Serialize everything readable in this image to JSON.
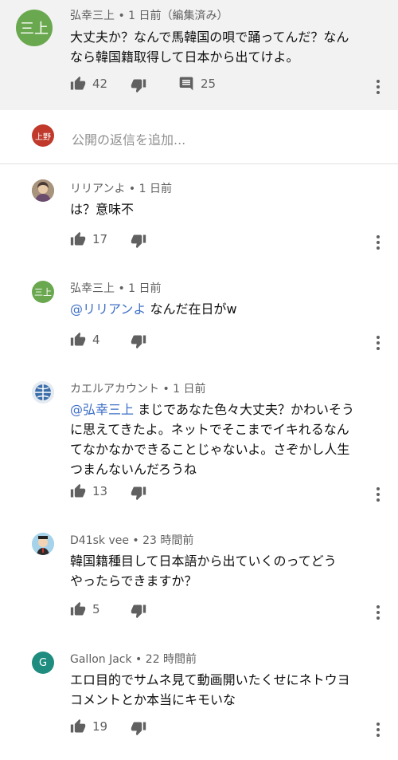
{
  "parent": {
    "avatar_text": "三上",
    "author": "弘幸三上",
    "time": "1 日前（編集済み）",
    "text_line1": "大丈夫か？なんで馬韓国の唄で踊ってんだ？なん",
    "text_line2": "なら韓国籍取得して日本から出てけよ。",
    "likes": "42",
    "replies": "25"
  },
  "reply_box": {
    "avatar_text": "上野",
    "placeholder": "公開の返信を追加..."
  },
  "replies": [
    {
      "author": "リリアンよ",
      "time": "1 日前",
      "lines": [
        "は？意味不"
      ],
      "likes": "17"
    },
    {
      "author": "弘幸三上",
      "avatar_text": "三上",
      "time": "1 日前",
      "mention": "@リリアンよ",
      "mention_rest": " なんだ在日がw",
      "likes": "4"
    },
    {
      "author": "カエルアカウント",
      "time": "1 日前",
      "mention": "@弘幸三上",
      "mention_rest": " まじであなた色々大丈夫？かわいそう",
      "lines": [
        "に思えてきたよ。ネットでそこまでイキれるなん",
        "てなかなかできることじゃないよ。さぞかし人生",
        "つまんないんだろうね"
      ],
      "likes": "13"
    },
    {
      "author": "D41sk vee",
      "time": "23 時間前",
      "lines": [
        "韓国籍種目して日本語から出ていくのってどう",
        "やったらできますか？"
      ],
      "likes": "5"
    },
    {
      "author": "Gallon Jack",
      "avatar_text": "G",
      "time": "22 時間前",
      "lines": [
        "エロ目的でサムネ見て動画開いたくせにネトウヨ",
        "コメントとか本当にキモいな"
      ],
      "likes": "19"
    }
  ],
  "colors": {
    "mention": "#3e6fc7",
    "green_avatar": "#6aa84f",
    "red_avatar": "#c0392b",
    "teal_avatar": "#1e8c7e"
  }
}
